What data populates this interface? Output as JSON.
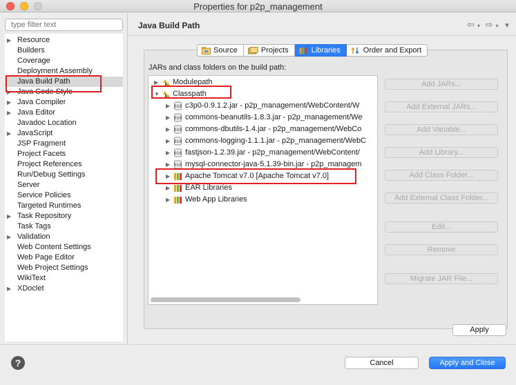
{
  "window": {
    "title": "Properties for p2p_management"
  },
  "sidebar": {
    "filter_placeholder": "type filter text",
    "items": [
      {
        "label": "Resource",
        "expandable": true
      },
      {
        "label": "Builders",
        "expandable": false
      },
      {
        "label": "Coverage",
        "expandable": false
      },
      {
        "label": "Deployment Assembly",
        "expandable": false
      },
      {
        "label": "Java Build Path",
        "expandable": false,
        "selected": true
      },
      {
        "label": "Java Code Style",
        "expandable": true
      },
      {
        "label": "Java Compiler",
        "expandable": true
      },
      {
        "label": "Java Editor",
        "expandable": true
      },
      {
        "label": "Javadoc Location",
        "expandable": false
      },
      {
        "label": "JavaScript",
        "expandable": true
      },
      {
        "label": "JSP Fragment",
        "expandable": false
      },
      {
        "label": "Project Facets",
        "expandable": false
      },
      {
        "label": "Project References",
        "expandable": false
      },
      {
        "label": "Run/Debug Settings",
        "expandable": false
      },
      {
        "label": "Server",
        "expandable": false
      },
      {
        "label": "Service Policies",
        "expandable": false
      },
      {
        "label": "Targeted Runtimes",
        "expandable": false
      },
      {
        "label": "Task Repository",
        "expandable": true
      },
      {
        "label": "Task Tags",
        "expandable": false
      },
      {
        "label": "Validation",
        "expandable": true
      },
      {
        "label": "Web Content Settings",
        "expandable": false
      },
      {
        "label": "Web Page Editor",
        "expandable": false
      },
      {
        "label": "Web Project Settings",
        "expandable": false
      },
      {
        "label": "WikiText",
        "expandable": false
      },
      {
        "label": "XDoclet",
        "expandable": true
      }
    ]
  },
  "main": {
    "title": "Java Build Path",
    "tabs": [
      {
        "label": "Source",
        "icon": "source-folder-icon"
      },
      {
        "label": "Projects",
        "icon": "projects-icon"
      },
      {
        "label": "Libraries",
        "icon": "libraries-icon",
        "active": true
      },
      {
        "label": "Order and Export",
        "icon": "order-export-icon"
      }
    ],
    "sublabel": "JARs and class folders on the build path:",
    "tree": {
      "modulepath": "Modulepath",
      "classpath": "Classpath",
      "jars": [
        "c3p0-0.9.1.2.jar - p2p_management/WebContent/W",
        "commons-beanutils-1.8.3.jar - p2p_management/We",
        "commons-dbutils-1.4.jar - p2p_management/WebCo",
        "commons-logging-1.1.1.jar - p2p_management/WebC",
        "fastjson-1.2.39.jar - p2p_management/WebContent/",
        "mysql-connector-java-5.1.39-bin.jar - p2p_managem"
      ],
      "libraries": [
        "Apache Tomcat v7.0 [Apache Tomcat v7.0]",
        "EAR Libraries",
        "Web App Libraries"
      ]
    },
    "buttons": [
      "Add JARs...",
      "Add External JARs...",
      "Add Variable...",
      "Add Library...",
      "Add Class Folder...",
      "Add External Class Folder...",
      "Edit...",
      "Remove",
      "Migrate JAR File..."
    ],
    "apply_label": "Apply"
  },
  "footer": {
    "help_label": "?",
    "cancel_label": "Cancel",
    "ok_label": "Apply and Close"
  },
  "colors": {
    "accent": "#2d7ff5",
    "highlight": "#e21f1f",
    "selection": "#d8d8d8"
  }
}
